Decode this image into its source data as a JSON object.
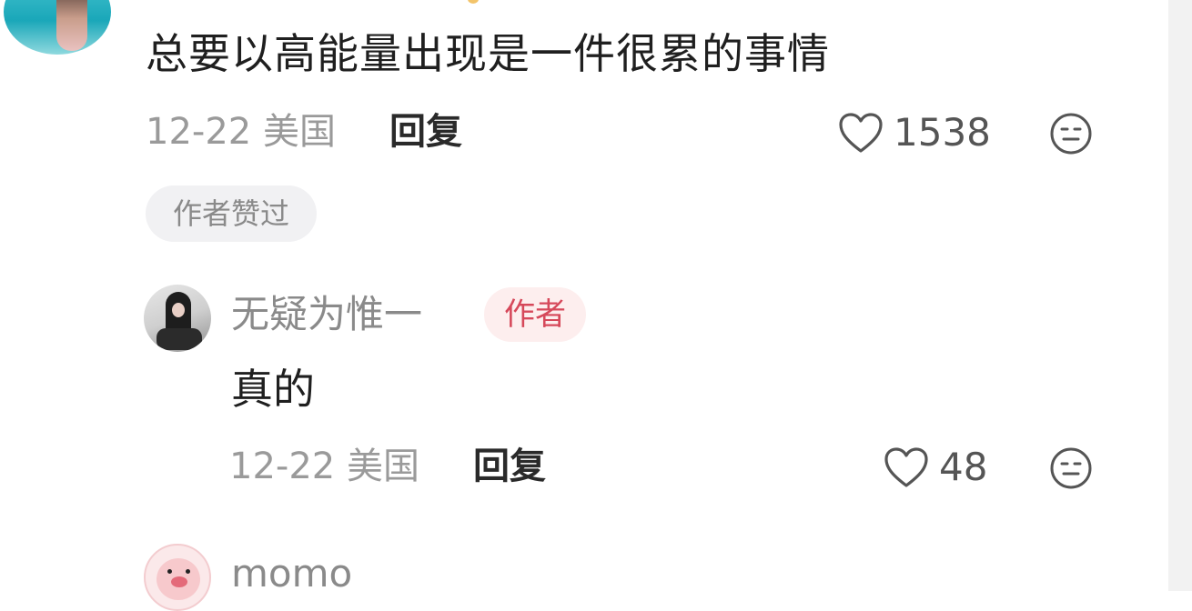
{
  "comment": {
    "text": "总要以高能量出现是一件很累的事情",
    "date": "12-22",
    "location": "美国",
    "reply_label": "回复",
    "likes": "1538",
    "author_liked_label": "作者赞过"
  },
  "reply": {
    "username": "无疑为惟一",
    "author_badge": "作者",
    "text": "真的",
    "date": "12-22",
    "location": "美国",
    "reply_label": "回复",
    "likes": "48"
  },
  "next_comment": {
    "username": "momo"
  },
  "icons": {
    "like": "heart-outline-icon",
    "emoji": "neutral-face-icon"
  },
  "colors": {
    "author_badge_text": "#d6485a",
    "author_badge_bg": "#fdeeee",
    "meta_text": "#9a9a9a"
  }
}
